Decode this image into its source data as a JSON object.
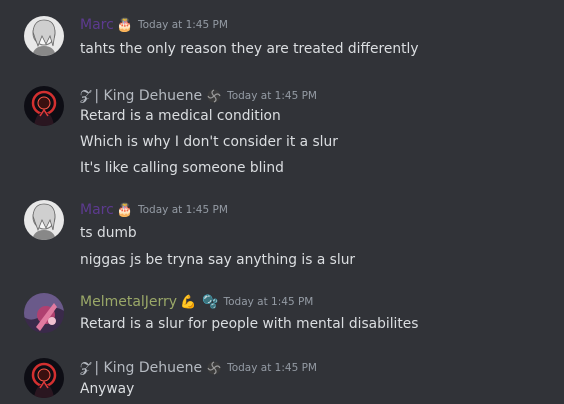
{
  "colors": {
    "background": "#313338",
    "marc_name": "#5c3a8f",
    "king_name": "#b5bac1",
    "jerry_name": "#9aa868",
    "timestamp": "#949ba4",
    "text": "#dbdee1"
  },
  "messages": [
    {
      "username": "Marc",
      "badge_icon": "cake-icon",
      "badge": "🎂",
      "timestamp": "Today at 1:45 PM",
      "lines": [
        "tahts the only reason they are treated differently"
      ]
    },
    {
      "username": "𝓩 | King Dehuene",
      "badge_icon": "swirl-icon",
      "timestamp": "Today at 1:45 PM",
      "lines": [
        "Retard is a medical condition",
        "Which is why I don't consider it a slur",
        "It's like calling someone blind"
      ]
    },
    {
      "username": "Marc",
      "badge_icon": "cake-icon",
      "badge": "🎂",
      "timestamp": "Today at 1:45 PM",
      "lines": [
        "ts dumb",
        "niggas js be tryna say anything is a slur"
      ]
    },
    {
      "username": "MelmetalJerry",
      "badge_icon": "flexed-bicep-icon",
      "badge": "💪",
      "badge2_icon": "bubbles-icon",
      "badge2": "🫧",
      "timestamp": "Today at 1:45 PM",
      "lines": [
        "Retard is a slur for people with mental disabilites"
      ]
    },
    {
      "username": "𝓩 | King Dehuene",
      "badge_icon": "swirl-icon",
      "timestamp": "Today at 1:45 PM",
      "lines": [
        "Anyway"
      ]
    }
  ]
}
